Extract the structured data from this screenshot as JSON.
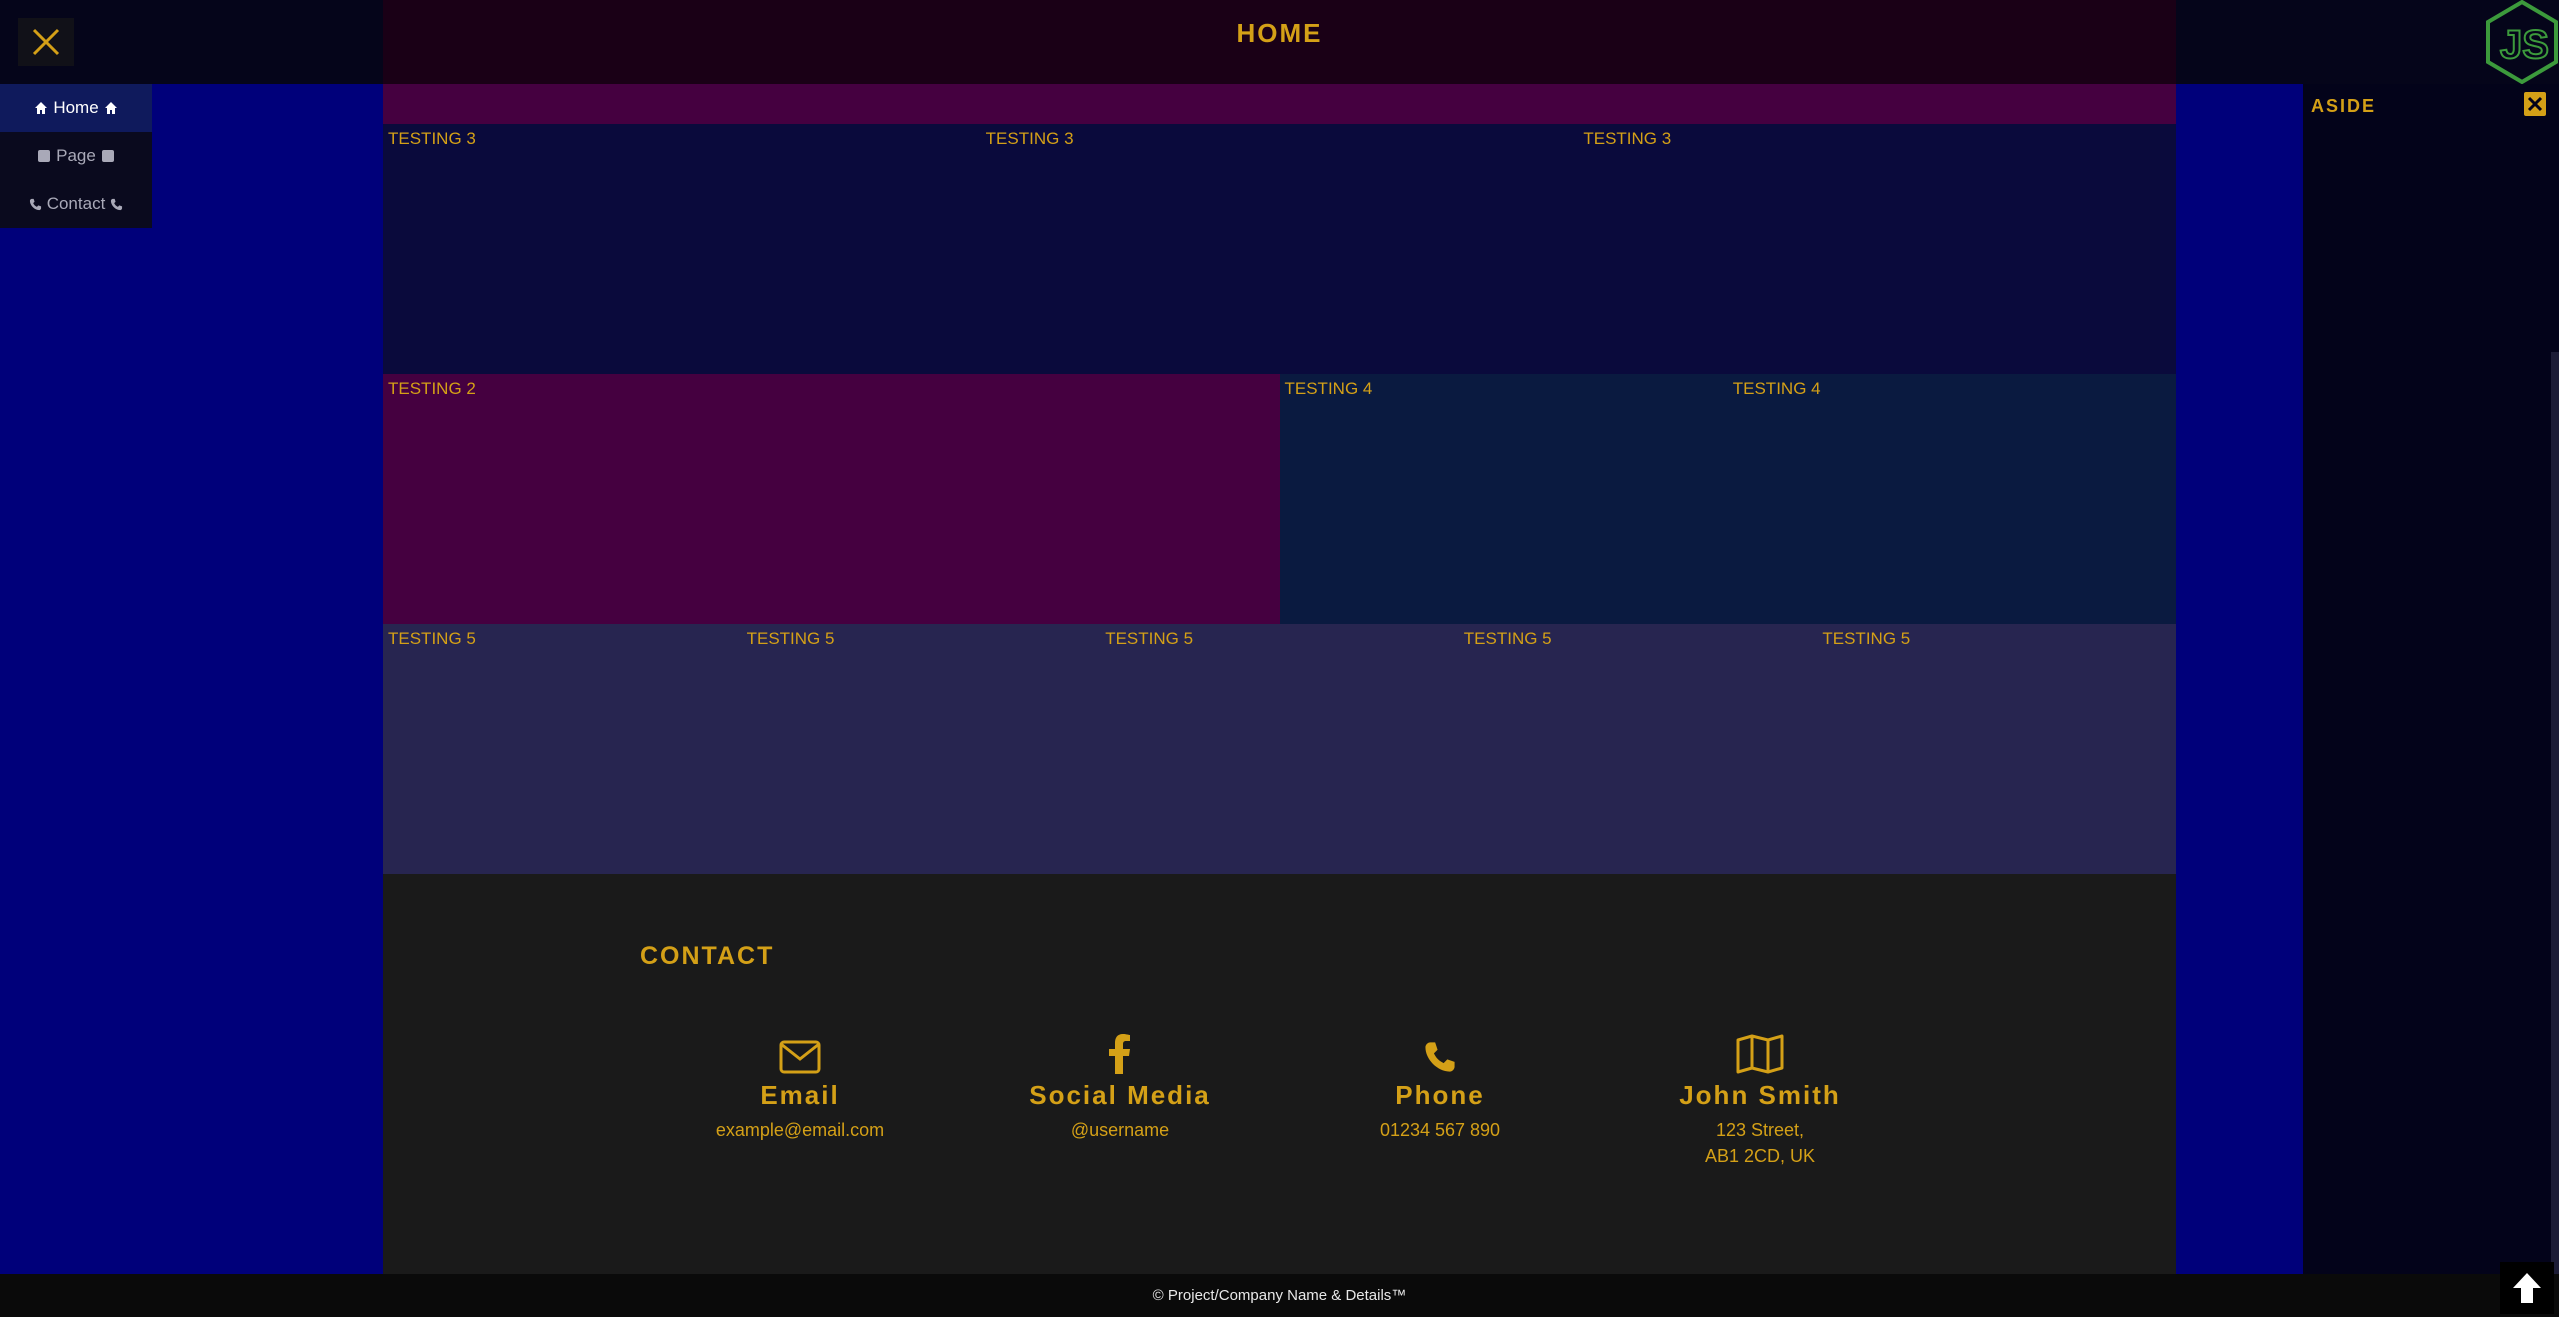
{
  "header": {
    "title": "HOME"
  },
  "nav": {
    "items": [
      {
        "label": "Home",
        "icon": "home-icon"
      },
      {
        "label": "Page",
        "icon": "square-icon"
      },
      {
        "label": "Contact",
        "icon": "phone-icon"
      }
    ]
  },
  "sections": {
    "row3": [
      "TESTING 3",
      "TESTING 3",
      "TESTING 3"
    ],
    "row2": [
      "TESTING 2",
      "TESTING 4",
      "TESTING 4"
    ],
    "row5": [
      "TESTING 5",
      "TESTING 5",
      "TESTING 5",
      "TESTING 5",
      "TESTING 5"
    ]
  },
  "contact": {
    "heading": "CONTACT",
    "items": [
      {
        "icon": "envelope-icon",
        "title": "Email",
        "value": "example@email.com"
      },
      {
        "icon": "facebook-icon",
        "title": "Social Media",
        "value": "@username"
      },
      {
        "icon": "phone-icon",
        "title": "Phone",
        "value": "01234 567 890"
      },
      {
        "icon": "map-icon",
        "title": "John Smith",
        "value": "123 Street,\nAB1 2CD, UK"
      }
    ]
  },
  "aside": {
    "title": "ASIDE"
  },
  "footer": {
    "text": "© Project/Company Name & Details™"
  },
  "colors": {
    "accent": "#d4a017",
    "background": "#00007a",
    "logo": "#3c9a3c"
  }
}
